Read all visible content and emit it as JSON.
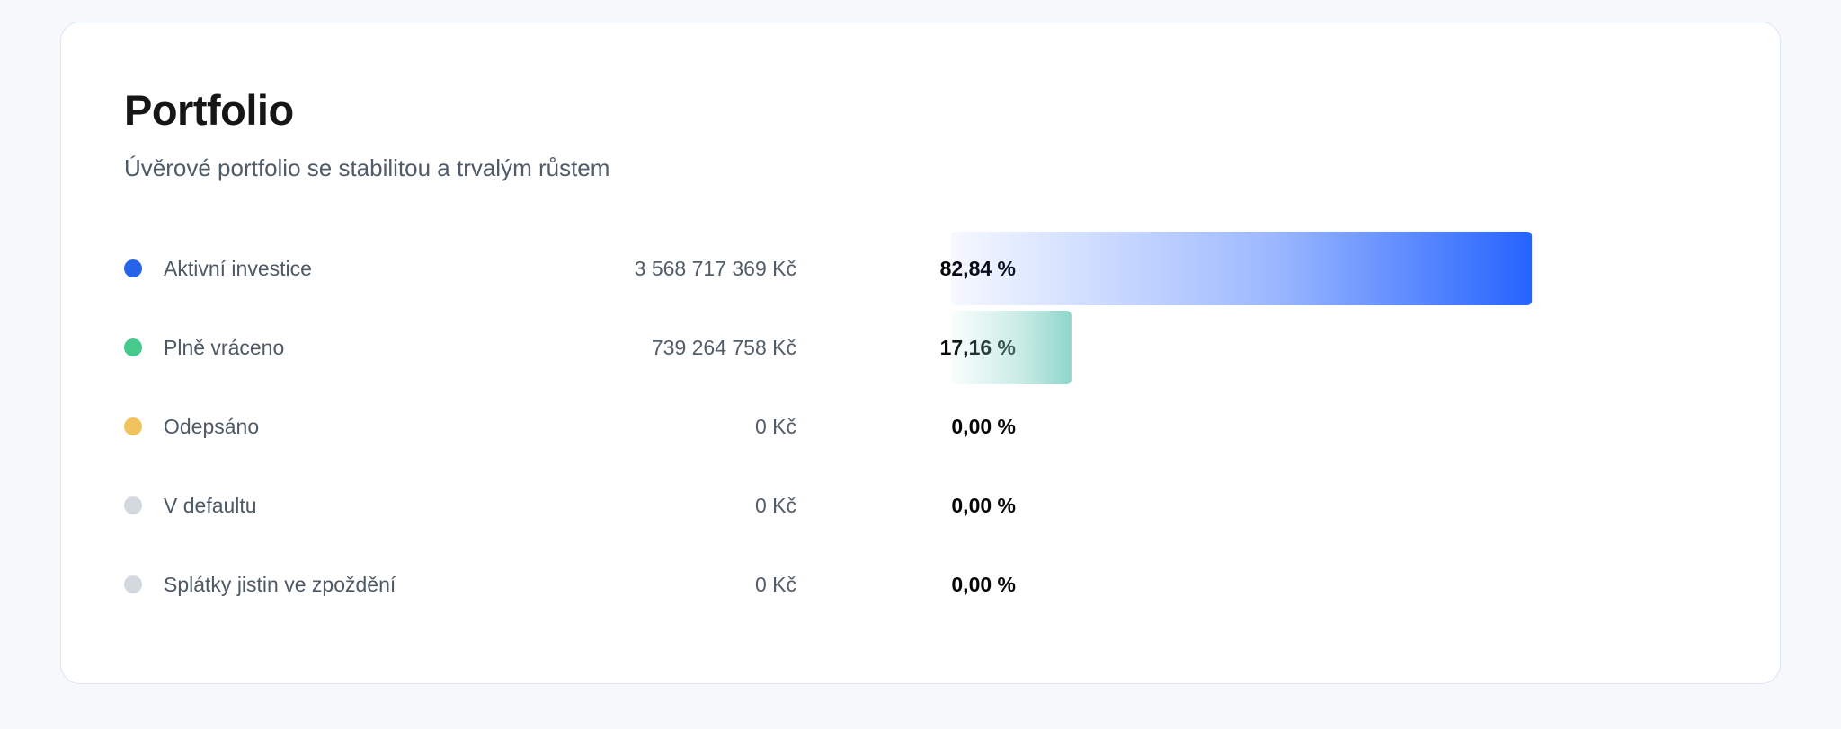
{
  "header": {
    "title": "Portfolio",
    "subtitle": "Úvěrové portfolio se stabilitou a trvalým růstem"
  },
  "chart_data": {
    "type": "bar",
    "orientation": "horizontal",
    "categories": [
      "Aktivní investice",
      "Plně vráceno",
      "Odepsáno",
      "V defaultu",
      "Splátky jistin ve zpoždění"
    ],
    "values": [
      82.84,
      17.16,
      0,
      0,
      0
    ],
    "amounts": [
      "3 568 717 369 Kč",
      "739 264 758 Kč",
      "0 Kč",
      "0 Kč",
      "0 Kč"
    ],
    "percent_labels": [
      "82,84 %",
      "17,16 %",
      "0,00 %",
      "0,00 %",
      "0,00 %"
    ],
    "colors": [
      "#2563eb",
      "#45c98c",
      "#f0c35e",
      "#d3d9df",
      "#d3d9df"
    ],
    "bar_colors": [
      "#2563ff",
      "#8fd6cb",
      "#f0c35e",
      "#d3d9df",
      "#d3d9df"
    ],
    "xlim": [
      0,
      100
    ],
    "grid": false,
    "legend": "left"
  }
}
